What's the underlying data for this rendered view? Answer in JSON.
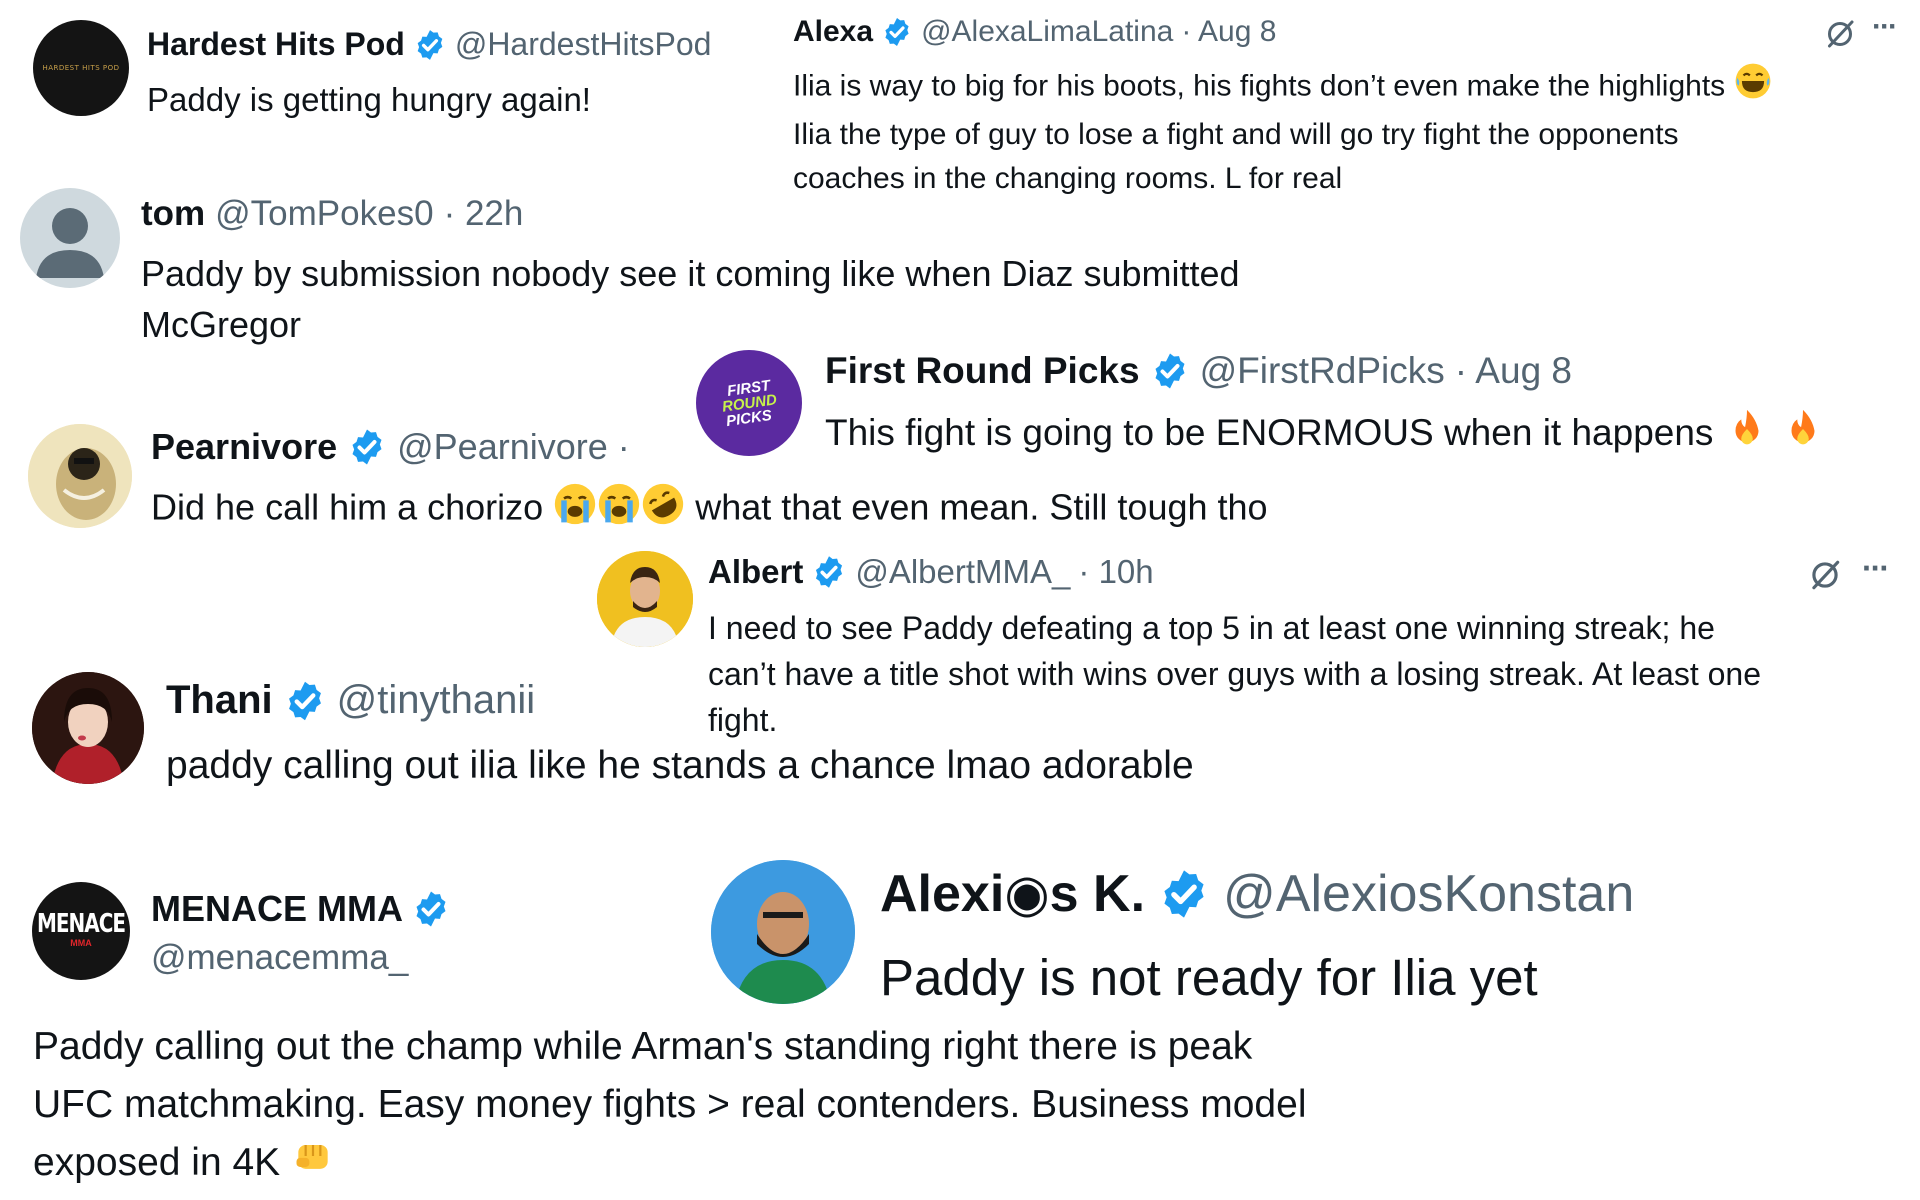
{
  "colors": {
    "verified": "#1d9bf0",
    "text": "#0f1419",
    "muted": "#536471"
  },
  "posts": [
    {
      "name": "Hardest Hits Pod",
      "handle": "@HardestHitsPod",
      "text": "Paddy is getting hungry again!",
      "avatar_text": "HARDEST HITS POD",
      "avatar": "hardest-hits-logo",
      "verified": true
    },
    {
      "name": "Alexa",
      "handle": "@AlexaLimaLatina",
      "meta": "· Aug 8",
      "lines": [
        "Ilia is way to big for his boots, his fights don’t even make the highlights",
        "Ilia the type of guy to lose a fight and will go try fight the opponents",
        "coaches in the changing rooms. L for real"
      ],
      "icons": [
        "grok-icon",
        "more-icon"
      ],
      "more_label": "···",
      "verified": true
    },
    {
      "name": "tom",
      "handle": "@TomPokes0",
      "meta": "· 22h",
      "lines": [
        "Paddy by submission nobody see it coming like when Diaz submitted",
        "McGregor"
      ],
      "avatar": "default-profile-icon",
      "verified": false
    },
    {
      "name": "First Round Picks",
      "handle": "@FirstRdPicks",
      "meta": "· Aug 8",
      "text": "This fight is going to be ENORMOUS when it happens",
      "avatar_lines": [
        "FIRST",
        "ROUND",
        "PICKS"
      ],
      "verified": true
    },
    {
      "name": "Pearnivore",
      "handle": "@Pearnivore",
      "meta": "·",
      "text_before": "Did he call him a chorizo",
      "text_after": "what that even mean. Still tough tho",
      "verified": true
    },
    {
      "name": "Albert",
      "handle": "@AlbertMMA_",
      "meta": "· 10h",
      "lines": [
        "I need to see Paddy defeating a top 5 in at least one winning streak; he",
        "can’t have a title shot with wins over guys with a losing streak. At least one",
        "fight."
      ],
      "icons": [
        "grok-icon",
        "more-icon"
      ],
      "more_label": "···",
      "verified": true
    },
    {
      "name": "Thani",
      "handle": "@tinythanii",
      "text": "paddy calling out ilia like he stands a chance lmao adorable",
      "verified": true
    },
    {
      "name": "MENACE MMA",
      "handle": "@menacemma_",
      "avatar_text": "MENACE",
      "avatar_subtext": "MMA",
      "lines": [
        "Paddy calling out the champ while Arman's standing right there is peak",
        "UFC matchmaking. Easy money fights > real contenders. Business model",
        "exposed in 4K"
      ],
      "verified": true
    },
    {
      "name": "Alexi◉s K.",
      "handle": "@AlexiosKonstan",
      "text": "Paddy is not ready for Ilia yet",
      "verified": true
    }
  ]
}
